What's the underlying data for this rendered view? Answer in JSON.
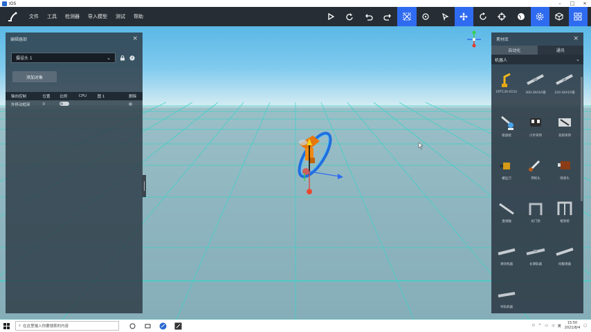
{
  "window": {
    "title": "IOS"
  },
  "menu": {
    "items": [
      "文件",
      "工具",
      "检测器",
      "导入模型",
      "测试",
      "帮助"
    ]
  },
  "toolbar": {
    "accent": "#2f6bf0",
    "tools": [
      {
        "icon": "play-icon",
        "active": false
      },
      {
        "icon": "redo-icon",
        "active": false
      },
      {
        "icon": "undo-icon",
        "active": false
      },
      {
        "icon": "forward-icon",
        "active": false
      },
      {
        "icon": "select-all-icon",
        "active": true
      },
      {
        "icon": "robot-icon",
        "active": false
      },
      {
        "icon": "cursor-icon",
        "active": false
      },
      {
        "icon": "move-icon",
        "active": true
      },
      {
        "icon": "rotate-icon",
        "active": false
      },
      {
        "icon": "target-icon",
        "active": false
      },
      {
        "icon": "globe-icon",
        "active": false
      },
      {
        "icon": "settings-icon",
        "active": true
      },
      {
        "icon": "cube-icon",
        "active": false
      },
      {
        "icon": "grid-icon",
        "active": true
      }
    ]
  },
  "left_panel": {
    "title": "编辑器部",
    "select_value": "摄设头 1",
    "add_button": "添加对象",
    "columns": [
      "轴向控制",
      "位置",
      "比例",
      "CPU",
      "图 1",
      "删除"
    ],
    "rows": [
      {
        "name": "外移动框架",
        "value": "0"
      }
    ]
  },
  "right_panel": {
    "title": "素材库",
    "tabs": [
      {
        "label": "自动化",
        "active": true
      },
      {
        "label": "通讯",
        "active": false
      }
    ],
    "category": "机器人",
    "items": [
      {
        "label": "EPT130-0154",
        "icon": "yellow-robot-icon"
      },
      {
        "label": "300-1KA1R基",
        "icon": "linear-rail-icon"
      },
      {
        "label": "220-1KA1R基",
        "icon": "linear-rail-icon"
      },
      {
        "label": "吸盘组",
        "icon": "suction-icon"
      },
      {
        "label": "爪手夹持",
        "icon": "gripper-icon"
      },
      {
        "label": "双抓夹持",
        "icon": "double-gripper-icon"
      },
      {
        "label": "螺丝刀",
        "icon": "screwdriver-icon"
      },
      {
        "label": "焊枪头",
        "icon": "welding-icon"
      },
      {
        "label": "喷涂头",
        "icon": "spray-icon"
      },
      {
        "label": "直线轴",
        "icon": "axis-icon"
      },
      {
        "label": "龙门架",
        "icon": "gantry-icon"
      },
      {
        "label": "框架组",
        "icon": "frame-icon"
      },
      {
        "label": "滑块机器",
        "icon": "slider-icon"
      },
      {
        "label": "长滑轨器",
        "icon": "long-rail-icon"
      },
      {
        "label": "伺服滑器",
        "icon": "servo-rail-icon"
      },
      {
        "label": "导轨机器",
        "icon": "guide-rail-icon"
      }
    ]
  },
  "taskbar": {
    "search_placeholder": "在这里输入你要搜索的内容",
    "time": "15:50",
    "date": "2021/8/4"
  }
}
